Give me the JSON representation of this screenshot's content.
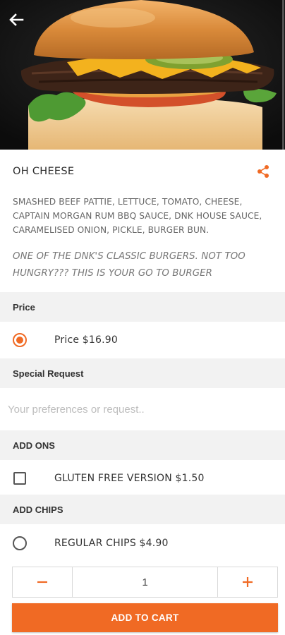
{
  "product": {
    "name": "OH CHEESE",
    "description": "SMASHED BEEF PATTIE, LETTUCE, TOMATO, CHEESE, CAPTAIN MORGAN RUM BBQ SAUCE, DNK HOUSE SAUCE, CARAMELISED ONION, PICKLE, BURGER BUN.",
    "tagline": "ONE OF THE DNK'S CLASSIC BURGERS. NOT TOO HUNGRY??? THIS IS YOUR GO TO BURGER"
  },
  "icons": {
    "back": "arrow-left-icon",
    "share": "share-icon",
    "minus": "minus-icon",
    "plus": "plus-icon"
  },
  "price_section": {
    "header": "Price",
    "options": [
      {
        "label": "Price  $16.90",
        "selected": true
      }
    ]
  },
  "special_request": {
    "header": "Special Request",
    "placeholder": "Your preferences or request..",
    "value": ""
  },
  "add_ons": {
    "header": "ADD ONS",
    "options": [
      {
        "label": "GLUTEN FREE VERSION  $1.50",
        "checked": false
      }
    ]
  },
  "add_chips": {
    "header": "ADD CHIPS",
    "options": [
      {
        "label": "REGULAR CHIPS  $4.90",
        "selected": false
      }
    ]
  },
  "quantity": {
    "value": "1"
  },
  "add_to_cart_label": "ADD TO CART",
  "colors": {
    "accent": "#f06a24",
    "section_bg": "#f2f2f2"
  }
}
